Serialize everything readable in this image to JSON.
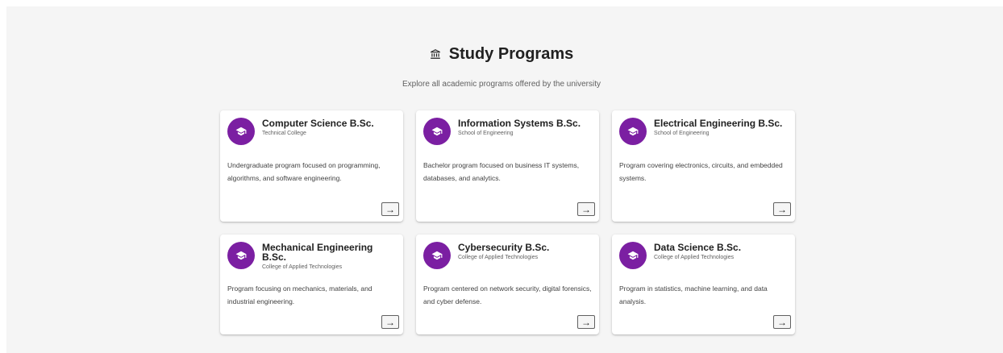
{
  "header": {
    "title": "Study Programs",
    "subtitle": "Explore all academic programs offered by the university",
    "icon": "institution-icon"
  },
  "programs": [
    {
      "title": "Computer Science B.Sc.",
      "college": "Technical College",
      "description": "Undergraduate program focused on programming, algorithms, and software engineering.",
      "icon": "graduation-cap-icon"
    },
    {
      "title": "Information Systems B.Sc.",
      "college": "School of Engineering",
      "description": "Bachelor program focused on business IT systems, databases, and analytics.",
      "icon": "graduation-cap-icon"
    },
    {
      "title": "Electrical Engineering B.Sc.",
      "college": "School of Engineering",
      "description": "Program covering electronics, circuits, and embedded systems.",
      "icon": "graduation-cap-icon"
    },
    {
      "title": "Mechanical Engineering B.Sc.",
      "college": "College of Applied Technologies",
      "description": "Program focusing on mechanics, materials, and industrial engineering.",
      "icon": "graduation-cap-icon"
    },
    {
      "title": "Cybersecurity B.Sc.",
      "college": "College of Applied Technologies",
      "description": "Program centered on network security, digital forensics, and cyber defense.",
      "icon": "graduation-cap-icon"
    },
    {
      "title": "Data Science B.Sc.",
      "college": "College of Applied Technologies",
      "description": "Program in statistics, machine learning, and data analysis.",
      "icon": "graduation-cap-icon"
    }
  ],
  "action_glyph": "→",
  "colors": {
    "accent": "#7b1fa2",
    "background": "#f5f5f5",
    "card": "#ffffff"
  }
}
